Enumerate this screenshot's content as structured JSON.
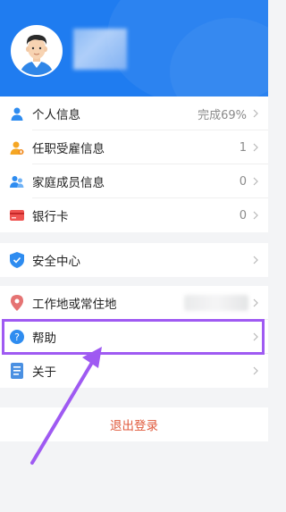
{
  "profile": {
    "avatar_icon": "user-avatar-icon"
  },
  "group1": [
    {
      "label": "个人信息",
      "value": "完成69%",
      "icon": "person-icon",
      "color": "#2e8cf0"
    },
    {
      "label": "任职受雇信息",
      "value": "1",
      "icon": "employment-person-icon",
      "color": "#f5a623"
    },
    {
      "label": "家庭成员信息",
      "value": "0",
      "icon": "family-members-icon",
      "color": "#2e8cf0"
    },
    {
      "label": "银行卡",
      "value": "0",
      "icon": "bank-card-icon",
      "color": "#ef5350"
    }
  ],
  "group2": [
    {
      "label": "安全中心",
      "icon": "shield-icon",
      "color": "#2e8cf0"
    }
  ],
  "group3": [
    {
      "label": "工作地或常住地",
      "icon": "location-pin-icon",
      "color": "#e57373"
    },
    {
      "label": "帮助",
      "icon": "help-question-icon",
      "color": "#2e8cf0"
    },
    {
      "label": "关于",
      "icon": "document-about-icon",
      "color": "#2e8cf0"
    }
  ],
  "logout": {
    "label": "退出登录"
  },
  "colors": {
    "header": "#1f7cf0",
    "highlight": "#9f5af2",
    "logout": "#e05a3c"
  }
}
